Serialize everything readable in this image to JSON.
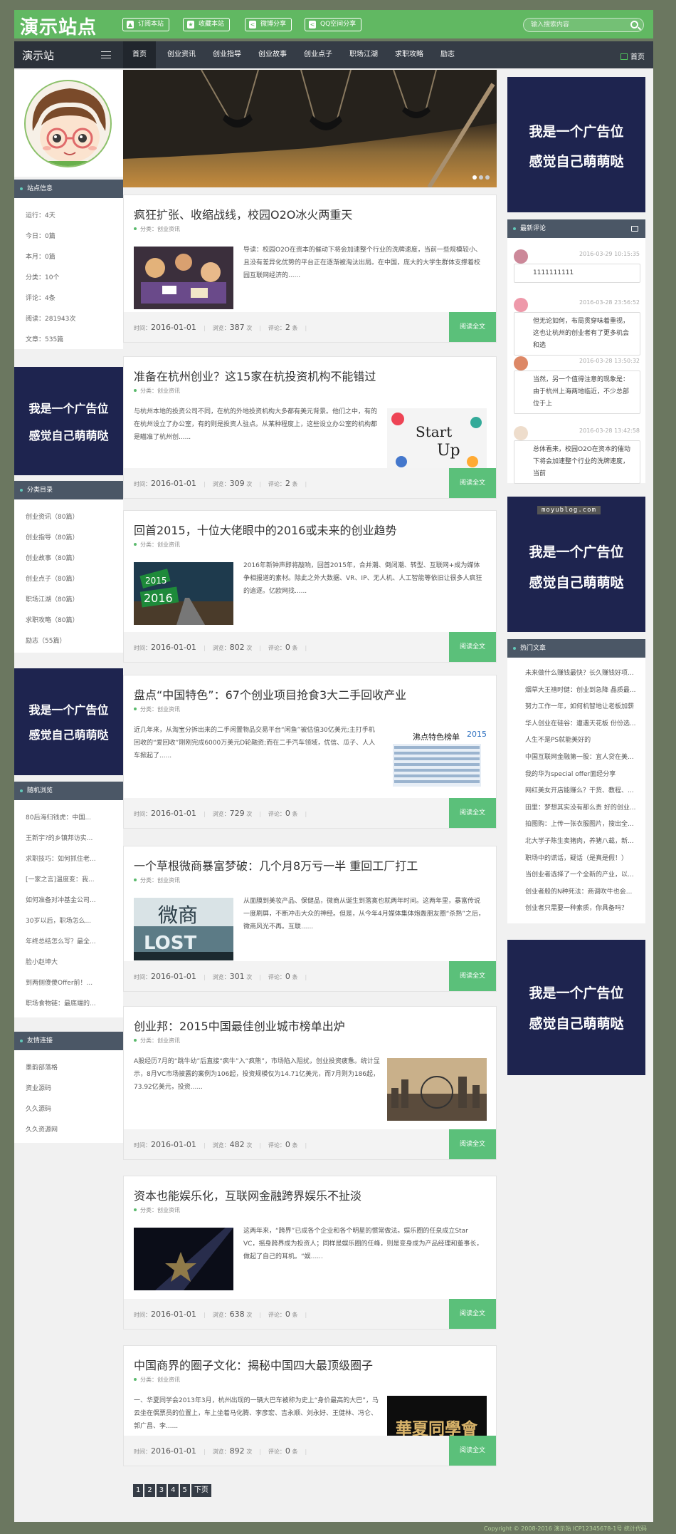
{
  "site": {
    "logo": "演示站点",
    "brand": "演示站",
    "copyright": "Copyright © 2008-2016  演示站 ICP12345678-1号  统计代码"
  },
  "topbar": {
    "buttons": [
      "订阅本站",
      "收藏本站",
      "微博分享",
      "QQ空间分享"
    ],
    "search_placeholder": "输入搜索内容"
  },
  "nav": {
    "items": [
      "首页",
      "创业资讯",
      "创业指导",
      "创业故事",
      "创业点子",
      "职场江湖",
      "求职攻略",
      "励志"
    ],
    "active": "首页",
    "home_link": "首页"
  },
  "left": {
    "info_title": "站点信息",
    "info": [
      "运行：4天",
      "今日：0篇",
      "本月：0篇",
      "分类：10个",
      "评论：4条",
      "阅读：281943次",
      "文章：535篇"
    ],
    "cat_title": "分类目录",
    "categories": [
      "创业资讯（80篇）",
      "创业指导（80篇）",
      "创业故事（80篇）",
      "创业点子（80篇）",
      "职场江湖（80篇）",
      "求职攻略（80篇）",
      "励志（55篇）"
    ],
    "random_title": "随机浏览",
    "random": [
      "80后海归钱虎：中国...",
      "王新宇?的乡镇邦访实...",
      "求职技巧：如何抓住老...",
      "[一家之言]温度变：我...",
      "如何准备对冲基金公司...",
      "30岁以后，职场怎么...",
      "年终总结怎么写？最全...",
      "脸小赵坤大",
      "到两侧傻傻Offer前！...",
      "职场食物链：最底端的..."
    ],
    "links_title": "友情连接",
    "links": [
      "墨韵部落格",
      "资业源码",
      "久久源码",
      "久久资源网"
    ]
  },
  "ads": {
    "line1": "我是一个广告位",
    "line2": "感觉自己萌萌哒",
    "tag": "moyublog.com"
  },
  "posts": [
    {
      "title": "疯狂扩张、收缩战线，校园O2O冰火两重天",
      "category": "分类：创业资讯",
      "excerpt": "导读：校园O2O在资本的催动下将会加速整个行业的洗牌速度，当前一些规模较小、且没有差异化优势的平台正在逐渐被淘汰出局。在中国，庞大的大学生群体支撑着校园互联网经济的......",
      "date": "2016-01-01",
      "views": "387",
      "comments": "2",
      "thumb_side": "left"
    },
    {
      "title": "准备在杭州创业？这15家在杭投资机构不能错过",
      "category": "分类：创业资讯",
      "excerpt": "与杭州本地的投资公司不同，在杭的外地投资机构大多都有美元背景。他们之中，有的在杭州设立了办公室，有的则是投资人驻点。从某种程度上，这些设立办公室的机构都是瞄准了杭州创......",
      "date": "2016-01-01",
      "views": "309",
      "comments": "2",
      "thumb_side": "right"
    },
    {
      "title": "回首2015，十位大佬眼中的2016或未来的创业趋势",
      "category": "分类：创业资讯",
      "excerpt": "2016年新钟声即将敲响，回首2015年，合并潮、倒闭潮、转型、互联网+成为媒体争相报道的素材。除此之外大数据、VR、IP、无人机、人工智能等依旧让很多人疯狂的追逐。亿欧网找......",
      "date": "2016-01-01",
      "views": "802",
      "comments": "0",
      "thumb_side": "left"
    },
    {
      "title": "盘点“中国特色”：67个创业项目抢食3大二手回收产业",
      "category": "分类：创业资讯",
      "excerpt": "近几年来，从淘宝分拆出来的二手闲置物品交易平台“闲鱼”被估值30亿美元;主打手机回收的“爱回收”刚刚完成6000万美元D轮融资;而在二手汽车领域，优信、瓜子、人人车掀起了......",
      "date": "2016-01-01",
      "views": "729",
      "comments": "0",
      "thumb_side": "right"
    },
    {
      "title": "一个草根微商暴富梦破：几个月8万亏一半 重回工厂打工",
      "category": "分类：创业资讯",
      "excerpt": "从面膜到美妆产品、保健品，微商从诞生到落寞也就两年时间。这两年里，暴富传说一度刷屏，不断冲击大众的神经。但是，从今年4月媒体集体炮轰朋友圈“杀熟”之后，微商风光不再。互联......",
      "date": "2016-01-01",
      "views": "301",
      "comments": "0",
      "thumb_side": "left"
    },
    {
      "title": "创业邦：2015中国最佳创业城市榜单出炉",
      "category": "分类：创业资讯",
      "excerpt": "A股经历7月的“跳牛幼”后直接“疯牛”入“疯熊”，市场陷入阻扰，创业投资疲惫。统计显示，8月VC市场披露的案例为106起，投资规模仅为14.71亿美元，而7月则为186起，73.92亿美元，投资......",
      "date": "2016-01-01",
      "views": "482",
      "comments": "0",
      "thumb_side": "right"
    },
    {
      "title": "资本也能娱乐化，互联网金融跨界娱乐不扯淡",
      "category": "分类：创业资讯",
      "excerpt": "这两年来，“跨界”已成各个企业和各个明星的惯常做法。娱乐圈的任泉成立Star VC，摇身跨界成为投资人；同样是娱乐圈的任峰，则是变身成为产品经理和董事长，做起了自己的耳机。“娱......",
      "date": "2016-01-01",
      "views": "638",
      "comments": "0",
      "thumb_side": "left"
    },
    {
      "title": "中国商界的圈子文化：揭秘中国四大最顶级圈子",
      "category": "分类：创业资讯",
      "excerpt": "一、华夏同学会2013年3月，杭州出现的一辆大巴车被称为史上“身价最高的大巴”，马云坐在偶票员的位置上，车上坐着马化腾、李彦宏、吉永顺、刘永好、王健林、冯仑、郭广昌、李......",
      "date": "2016-01-01",
      "views": "892",
      "comments": "0",
      "thumb_side": "right"
    }
  ],
  "post_labels": {
    "time": "时间：",
    "views": "浏览：",
    "views_unit": "次",
    "comments": "评论：",
    "comments_unit": "条",
    "more": "阅读全文"
  },
  "pager": [
    "1",
    "2",
    "3",
    "4",
    "5",
    "下页"
  ],
  "right": {
    "comments_title": "最新评论",
    "comments": [
      {
        "time": "2016-03-29 10:15:35",
        "text": "1111111111"
      },
      {
        "time": "2016-03-28 23:56:52",
        "text": "但无论如何，布局贯穿味着重视，这也让杭州的创业者有了更多机会和选"
      },
      {
        "time": "2016-03-28 13:50:32",
        "text": "当然，另一个值得注意的现象是：由于杭州上海两地临近，不少总部位于上"
      },
      {
        "time": "2016-03-28 13:42:58",
        "text": "总体看来，校园O2O在资本的催动下将会加速整个行业的洗牌速度，当前"
      }
    ],
    "hot_title": "热门文章",
    "hot": [
      "未来做什么赚钱最快？长久赚钱好项...",
      "烟草大王禧时健：创业到急降 晶质最...",
      "努力工作一年，如何机智地让老板加薪",
      "华人创业在硅谷：遭遇天花板 份份选...",
      "人生不是PS就能美好的",
      "中国互联网金融第一股：宜人贷在美...",
      "我的华为special offer面经分享",
      "网红美女开店能赚么？干货、教程、...",
      "田里：梦想其实没有那么贵 好的创业...",
      "拍图购：上传一张衣服图片，搜出全...",
      "北大学子陈生卖猪肉，养猪八载，新...",
      "职场中的谎话，疑话（是真是假！）",
      "当创业者选择了一个全新的产业，以...",
      "创业者般的N种死法：商调吹牛也会...",
      "创业者只需要一种素质，你具备吗？"
    ]
  }
}
